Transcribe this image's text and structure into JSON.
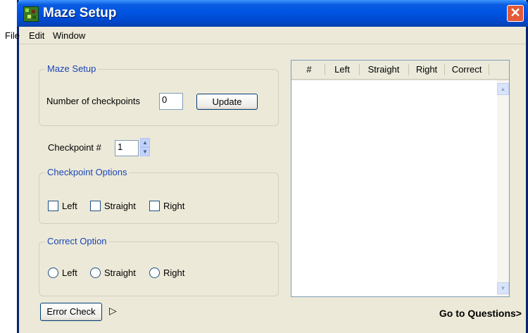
{
  "window": {
    "title": "Maze Setup",
    "close_glyph": "✕"
  },
  "menu": [
    "File",
    "Edit",
    "Window"
  ],
  "maze_setup": {
    "group_title": "Maze Setup",
    "checkpoints_label": "Number of checkpoints",
    "checkpoints_value": "0",
    "update_label": "Update"
  },
  "checkpoint": {
    "label": "Checkpoint #",
    "value": "1"
  },
  "checkpoint_options": {
    "group_title": "Checkpoint Options",
    "items": [
      "Left",
      "Straight",
      "Right"
    ]
  },
  "correct_option": {
    "group_title": "Correct Option",
    "items": [
      "Left",
      "Straight",
      "Right"
    ]
  },
  "list": {
    "columns": [
      "#",
      "Left",
      "Straight",
      "Right",
      "Correct"
    ]
  },
  "footer": {
    "error_check_label": "Error Check",
    "arrow_glyph": "▷",
    "go_to_label": "Go to Questions>"
  },
  "icons": [
    "maze-icon",
    "close-icon",
    "spin-up-icon",
    "spin-down-icon",
    "scroll-up-icon",
    "scroll-down-icon",
    "play-arrow-icon"
  ],
  "colors": {
    "titlebar": "#0054e3",
    "group_title": "#1a46b8",
    "window_bg": "#ece9d8",
    "close": "#e35a38"
  }
}
